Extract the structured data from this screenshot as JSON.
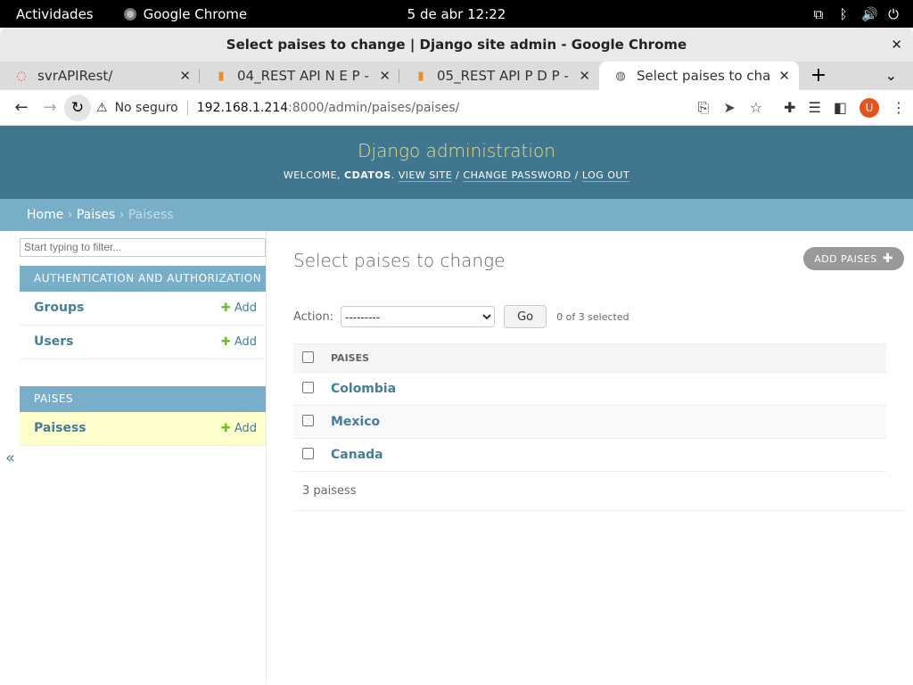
{
  "system": {
    "activities": "Actividades",
    "app_name": "Google Chrome",
    "clock": "5 de abr  12:22",
    "tray_icons": [
      "network-icon",
      "bluetooth-icon",
      "volume-icon",
      "power-icon"
    ]
  },
  "window": {
    "title": "Select paises to change | Django site admin - Google Chrome",
    "close": "✕"
  },
  "tabs": [
    {
      "label": "svrAPIRest/",
      "icon": "loading-icon"
    },
    {
      "label": "04_REST API N E P - Jup",
      "icon": "notebook-icon"
    },
    {
      "label": "05_REST API P D P - Jup",
      "icon": "notebook-icon"
    },
    {
      "label": "Select paises to change",
      "icon": "globe-icon"
    }
  ],
  "toolbar": {
    "insecure_label": "No seguro",
    "url_host": "192.168.1.214",
    "url_path": ":8000/admin/paises/paises/",
    "avatar_letter": "U"
  },
  "django": {
    "brand": "Django administration",
    "welcome": "WELCOME,",
    "user": "CDATOS",
    "view_site": "VIEW SITE",
    "change_password": "CHANGE PASSWORD",
    "log_out": "LOG OUT"
  },
  "breadcrumbs": {
    "home": "Home",
    "app": "Paises",
    "current": "Paisess"
  },
  "sidebar": {
    "filter_placeholder": "Start typing to filter...",
    "auth_caption": "AUTHENTICATION AND AUTHORIZATION",
    "groups": "Groups",
    "users": "Users",
    "paises_caption": "PAISES",
    "paisess": "Paisess",
    "add_label": "Add",
    "toggle": "«"
  },
  "content": {
    "title": "Select paises to change",
    "add_button": "ADD PAISES",
    "action_label": "Action:",
    "action_default": "---------",
    "go": "Go",
    "selected_counter": "0 of 3 selected",
    "column_header": "PAISES",
    "rows": [
      "Colombia",
      "Mexico",
      "Canada"
    ],
    "paginator": "3 paisess"
  }
}
